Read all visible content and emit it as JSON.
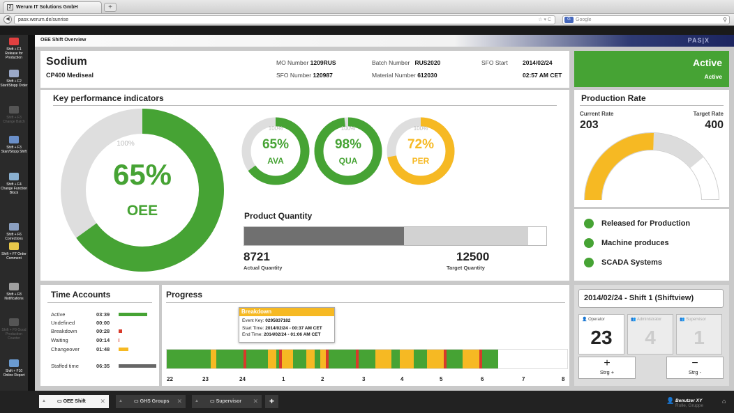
{
  "browser": {
    "tab_title": "Werum IT Solutions GmbH",
    "new_tab": "+",
    "url": "pasx.werum.de/sunrise",
    "search_placeholder": "Google",
    "search_engine": "G"
  },
  "app": {
    "title": "OEE Shift Overview",
    "logo": "PAS|X"
  },
  "sidebar": [
    {
      "label": "Shift + F1 Release for Production",
      "enabled": true,
      "color": "#e04040"
    },
    {
      "label": "Shift + F2 Start/Stopp Order",
      "enabled": true,
      "color": "#9aa8c8"
    },
    {
      "label": "Shift + F3 Change Batch",
      "enabled": false,
      "color": "#555555"
    },
    {
      "label": "Shift + F3 Start/Stopp Shift",
      "enabled": true,
      "color": "#6a8fc9"
    },
    {
      "label": "Shift + F4 Change Function Block",
      "enabled": true,
      "color": "#8ab0d0"
    },
    {
      "label": "Shift + F6 Corrections",
      "enabled": true,
      "color": "#8a9fc0"
    },
    {
      "label": "Shift + F7 Order Comment",
      "enabled": true,
      "color": "#e8c84a"
    },
    {
      "label": "Shift + F8 Notifications",
      "enabled": true,
      "color": "#a0a0a0"
    },
    {
      "label": "Shift + F9 Good Production Counter",
      "enabled": false,
      "color": "#555555"
    },
    {
      "label": "Shift + F10 Online Report",
      "enabled": true,
      "color": "#6a9ad0"
    }
  ],
  "header": {
    "product": "Sodium",
    "line": "CP400 Mediseal",
    "mo_label": "MO Number",
    "mo_value": "1209RUS",
    "batch_label": "Batch Number",
    "batch_value": "RUS2020",
    "sfo_start_label": "SFO Start",
    "sfo_start_date": "2014/02/24",
    "sfo_start_time": "02:57 AM CET",
    "sfo_label": "SFO Number",
    "sfo_value": "120987",
    "material_label": "Material Number",
    "material_value": "612030"
  },
  "status_box": {
    "title": "Active",
    "subtitle": "Active",
    "color": "#46a334"
  },
  "kpi": {
    "title": "Key performance indicators",
    "gauges": [
      {
        "pct_text": "65%",
        "name": "OEE",
        "ref": "100%",
        "fraction": 0.65,
        "color": "#46a334"
      },
      {
        "pct_text": "65%",
        "name": "AVA",
        "ref": "100%",
        "fraction": 0.65,
        "color": "#46a334"
      },
      {
        "pct_text": "98%",
        "name": "QUA",
        "ref": "100%",
        "fraction": 0.98,
        "color": "#46a334"
      },
      {
        "pct_text": "72%",
        "name": "PER",
        "ref": "100%",
        "fraction": 0.72,
        "color": "#f6b923"
      }
    ],
    "product_quantity": {
      "title": "Product Quantity",
      "actual": "8721",
      "actual_label": "Actual Quantity",
      "target": "12500",
      "target_label": "Target Quantity",
      "actual_fraction": 0.53,
      "secondary_fraction": 0.41
    }
  },
  "production_rate": {
    "title": "Production Rate",
    "current_label": "Current Rate",
    "current": "203",
    "target_label": "Target Rate",
    "target": "400",
    "fraction": 0.51,
    "secondary_fraction": 0.27
  },
  "systems": [
    {
      "label": "Released for Production",
      "color": "#46a334"
    },
    {
      "label": "Machine produces",
      "color": "#46a334"
    },
    {
      "label": "SCADA Systems",
      "color": "#46a334"
    }
  ],
  "time_accounts": {
    "title": "Time Accounts",
    "rows": [
      {
        "label": "Active",
        "value": "03:39",
        "color": "#46a334",
        "fraction": 0.6
      },
      {
        "label": "Undefined",
        "value": "00:00",
        "color": "#cccccc",
        "fraction": 0
      },
      {
        "label": "Breakdown",
        "value": "00:28",
        "color": "#d83a2a",
        "fraction": 0.08
      },
      {
        "label": "Waiting",
        "value": "00:14",
        "color": "#d83a2a",
        "fraction": 0.02
      },
      {
        "label": "Changeover",
        "value": "01:48",
        "color": "#f6b923",
        "fraction": 0.2
      },
      {
        "label": "Staffed time",
        "value": "06:35",
        "color": "#666666",
        "fraction": 0.8
      }
    ]
  },
  "progress": {
    "title": "Progress",
    "hours": [
      "22",
      "23",
      "24",
      "1",
      "2",
      "3",
      "4",
      "5",
      "6",
      "7",
      "8"
    ],
    "tooltip": {
      "title": "Breakdown",
      "event_label": "Event Key:",
      "event": "0295837182",
      "start_label": "Start Time:",
      "start": "2014/02/24 - 00:37 AM CET",
      "end_label": "End Time:",
      "end": "2014/02/24 - 01:06 AM CET"
    },
    "segments": [
      {
        "s": "active",
        "w": 16
      },
      {
        "s": "changeover",
        "w": 2
      },
      {
        "s": "active",
        "w": 10
      },
      {
        "s": "breakdown",
        "w": 1
      },
      {
        "s": "active",
        "w": 8
      },
      {
        "s": "changeover",
        "w": 3
      },
      {
        "s": "active",
        "w": 1
      },
      {
        "s": "breakdown",
        "w": 1
      },
      {
        "s": "changeover",
        "w": 4
      },
      {
        "s": "active",
        "w": 5
      },
      {
        "s": "changeover",
        "w": 3
      },
      {
        "s": "active",
        "w": 2
      },
      {
        "s": "changeover",
        "w": 2
      },
      {
        "s": "breakdown",
        "w": 1
      },
      {
        "s": "active",
        "w": 10
      },
      {
        "s": "breakdown",
        "w": 1
      },
      {
        "s": "active",
        "w": 6
      },
      {
        "s": "changeover",
        "w": 6
      },
      {
        "s": "active",
        "w": 3
      },
      {
        "s": "changeover",
        "w": 5
      },
      {
        "s": "active",
        "w": 5
      },
      {
        "s": "changeover",
        "w": 6
      },
      {
        "s": "breakdown",
        "w": 1
      },
      {
        "s": "active",
        "w": 6
      },
      {
        "s": "changeover",
        "w": 6
      },
      {
        "s": "breakdown",
        "w": 1
      },
      {
        "s": "active",
        "w": 6
      },
      {
        "s": "idle",
        "w": 25
      }
    ],
    "colors": {
      "active": "#46a334",
      "changeover": "#f6b923",
      "breakdown": "#d83a2a",
      "idle": "#ffffff"
    }
  },
  "shift": {
    "title": "2014/02/24 - Shift 1 (Shiftview)",
    "roles": [
      {
        "label": "Operator",
        "count": "23"
      },
      {
        "label": "Administrator",
        "count": "4"
      },
      {
        "label": "Supervisor",
        "count": "1"
      }
    ],
    "plus_label": "Strg +",
    "minus_label": "Strg -"
  },
  "taskbar": {
    "tabs": [
      "OEE Shift",
      "GHS Groups",
      "Supervisor"
    ],
    "add": "+",
    "user_name": "Benutzer XY",
    "user_sub": "Rolle, Gruppe"
  }
}
